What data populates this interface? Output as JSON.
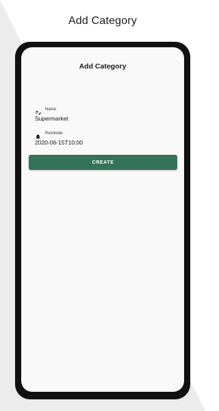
{
  "header": {
    "title": "Add Category"
  },
  "app": {
    "title": "Add Category",
    "fields": [
      {
        "icon": "edit-note-icon",
        "label": "Name",
        "value": "Supermarket"
      },
      {
        "icon": "bell-icon",
        "label": "Reminder",
        "value": "2020-06-15T10:00"
      }
    ],
    "create_label": "CREATE"
  },
  "colors": {
    "accent": "#33735a",
    "background_wedge": "#ececec",
    "phone_frame": "#111111",
    "screen_bg": "#f9f9f9"
  }
}
